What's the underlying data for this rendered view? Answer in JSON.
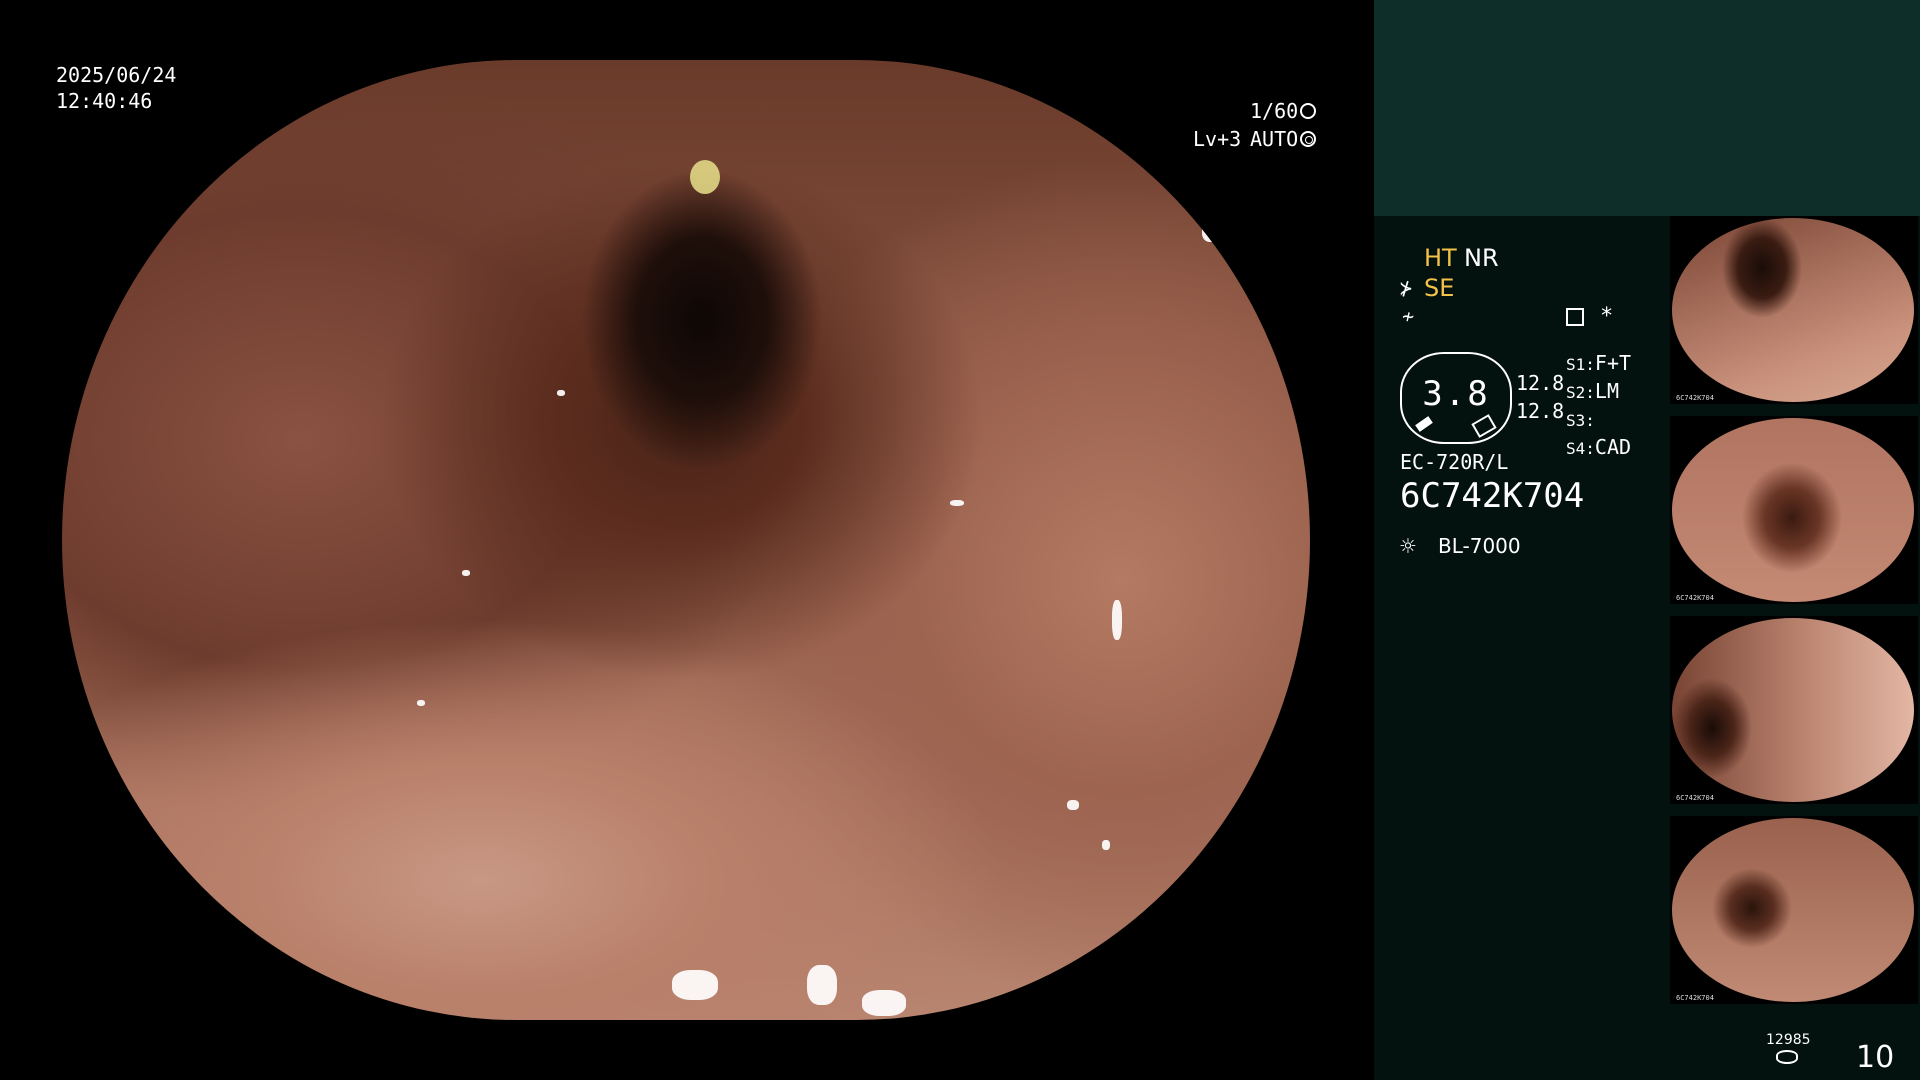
{
  "osd": {
    "date": "2025/06/24",
    "time": "12:40:46",
    "shutter": "1/60",
    "level": "Lv+3",
    "iris": "AUTO"
  },
  "panel": {
    "ht": "HT",
    "nr": "NR",
    "se": "SE",
    "gauge_value": "3.8",
    "gauge_right_1": "12.8",
    "gauge_right_2": "12.8",
    "switches": [
      {
        "key": "S1:",
        "value": "F+T"
      },
      {
        "key": "S2:",
        "value": "LM"
      },
      {
        "key": "S3:",
        "value": ""
      },
      {
        "key": "S4:",
        "value": "CAD"
      }
    ],
    "scope_model": "EC-720R/L",
    "scope_serial": "6C742K704",
    "light_source": "BL-7000",
    "image_count": "12985",
    "capture_count": "10"
  },
  "icons": {
    "shutter": "aperture-icon",
    "iris": "iris-icon",
    "light": "sun-icon",
    "storage": "storage-icon"
  },
  "thumbnails": [
    {
      "serial": "6C742K704"
    },
    {
      "serial": "6C742K704"
    },
    {
      "serial": "6C742K704"
    },
    {
      "serial": "6C742K704"
    }
  ],
  "colors": {
    "accent_yellow": "#f3c24a",
    "panel_bg": "#03110f",
    "panel_top": "#0e2e2a"
  }
}
